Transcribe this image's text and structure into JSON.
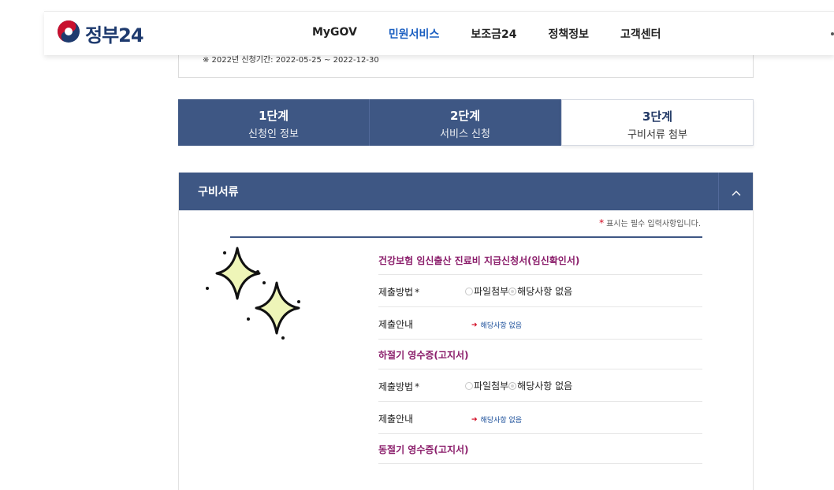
{
  "header": {
    "logo_text": "정부24",
    "nav": [
      "MyGOV",
      "민원서비스",
      "보조금24",
      "정책정보",
      "고객센터"
    ],
    "active_nav": "민원서비스"
  },
  "notice": {
    "text": "※ 2022년 신청기간: 2022-05-25 ~ 2022-12-30"
  },
  "steps": [
    {
      "num": "1단계",
      "label": "신청인 정보"
    },
    {
      "num": "2단계",
      "label": "서비스 신청"
    },
    {
      "num": "3단계",
      "label": "구비서류 첨부"
    }
  ],
  "section": {
    "title": "구비서류",
    "required_note": "표시는 필수 입력사항입니다.",
    "required_mark": "*"
  },
  "documents": [
    {
      "title": "건강보험 임신출산 진료비 지급신청서(임신확인서)",
      "method_label": "제출방법",
      "method_required": "*",
      "options": [
        "파일첨부",
        "해당사항 없음"
      ],
      "selected_option": "해당사항 없음",
      "guide_label": "제출안내",
      "guide_text": "해당사항 없음"
    },
    {
      "title": "하절기 영수증(고지서)",
      "method_label": "제출방법",
      "method_required": "*",
      "options": [
        "파일첨부",
        "해당사항 없음"
      ],
      "selected_option": "해당사항 없음",
      "guide_label": "제출안내",
      "guide_text": "해당사항 없음"
    },
    {
      "title": "동절기 영수증(고지서)"
    }
  ],
  "colors": {
    "navy": "#3e5784",
    "doc_title": "#8b1e6b",
    "active_nav": "#1b5fc1",
    "required_star": "#d0021b",
    "sparkle_fill": "#eef5b8"
  },
  "icons": {
    "logo": "taegeuk-logo-icon",
    "toggle": "chevron-up-icon",
    "decor": "sparkles-icon",
    "guide_arrow": "arrow-right-icon"
  }
}
